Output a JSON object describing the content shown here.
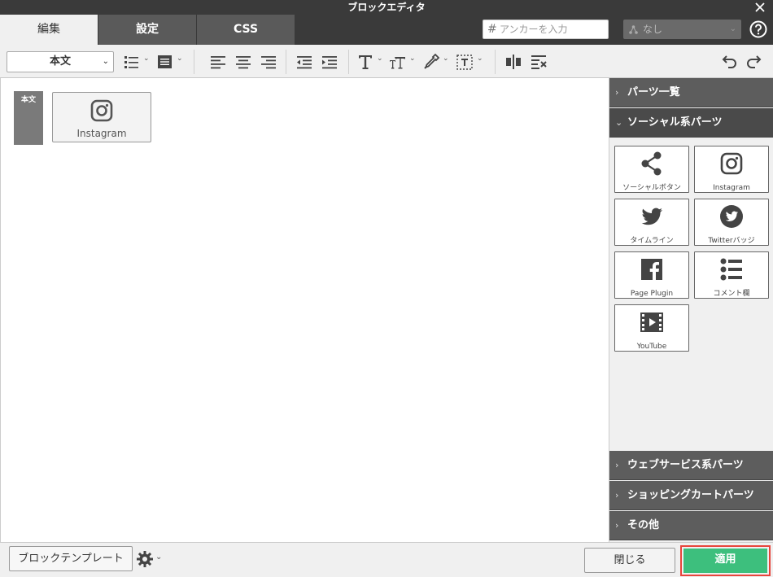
{
  "window": {
    "title": "ブロックエディタ"
  },
  "tabs": [
    {
      "label": "編集",
      "active": true
    },
    {
      "label": "設定",
      "active": false
    },
    {
      "label": "CSS",
      "active": false
    }
  ],
  "anchor": {
    "placeholder": "アンカーを入力"
  },
  "style_select": {
    "value": "なし"
  },
  "toolbar": {
    "format_select": "本文",
    "icons": [
      "list-icon",
      "block-format-icon",
      "align-left-icon",
      "align-center-icon",
      "align-right-icon",
      "outdent-icon",
      "indent-icon",
      "text-style-icon",
      "font-size-icon",
      "color-picker-icon",
      "text-frame-icon",
      "split-block-icon",
      "clear-format-icon",
      "undo-icon",
      "redo-icon"
    ]
  },
  "editor": {
    "block_tag": "本文",
    "block_label": "Instagram"
  },
  "sidebar": {
    "sections": [
      {
        "label": "パーツ一覧",
        "open": false
      },
      {
        "label": "ソーシャル系パーツ",
        "open": true
      },
      {
        "label": "ウェブサービス系パーツ",
        "open": false
      },
      {
        "label": "ショッピングカートパーツ",
        "open": false
      },
      {
        "label": "その他",
        "open": false
      }
    ],
    "parts": [
      {
        "label": "ソーシャルボタン",
        "icon": "share-icon"
      },
      {
        "label": "Instagram",
        "icon": "instagram-icon"
      },
      {
        "label": "タイムライン",
        "icon": "twitter-icon"
      },
      {
        "label": "Twitterバッジ",
        "icon": "twitter-badge-icon"
      },
      {
        "label": "Page Plugin",
        "icon": "facebook-icon"
      },
      {
        "label": "コメント欄",
        "icon": "comment-list-icon"
      },
      {
        "label": "YouTube",
        "icon": "film-icon"
      }
    ]
  },
  "bottom": {
    "template_button": "ブロックテンプレート",
    "close_button": "閉じる",
    "apply_button": "適用"
  },
  "colors": {
    "accent": "#3dbf7d",
    "highlight": "#e8453c",
    "dark": "#3a3a3a"
  }
}
